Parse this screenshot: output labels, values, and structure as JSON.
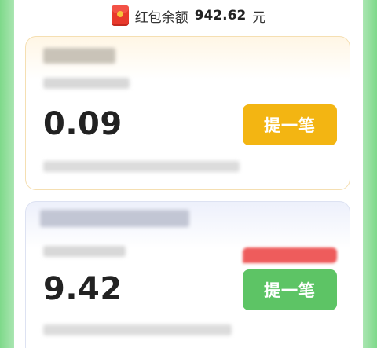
{
  "header": {
    "balance_label": "红包余额",
    "balance_amount": "942.62",
    "balance_unit": "元",
    "icon": "red-packet-icon"
  },
  "cards": [
    {
      "amount": "0.09",
      "button_label": "提一笔",
      "button_color": "#f3b512"
    },
    {
      "amount": "9.42",
      "button_label": "提一笔",
      "button_color": "#5dc465"
    }
  ],
  "colors": {
    "side_accent": "#7ed98a",
    "card1_border": "#f5dfb2",
    "card2_border": "#dde2f2"
  }
}
